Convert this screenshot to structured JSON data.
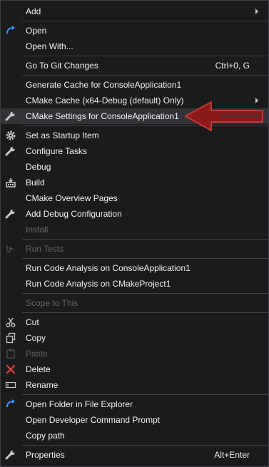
{
  "menu": {
    "items": [
      {
        "label": "Add",
        "shortcut": "",
        "submenu": true,
        "icon": "",
        "disabled": false
      },
      {
        "label": "Open",
        "shortcut": "",
        "submenu": false,
        "icon": "open-arrow-icon",
        "disabled": false
      },
      {
        "label": "Open With...",
        "shortcut": "",
        "submenu": false,
        "icon": "",
        "disabled": false
      },
      {
        "label": "Go To Git Changes",
        "shortcut": "Ctrl+0, G",
        "submenu": false,
        "icon": "",
        "disabled": false
      },
      {
        "label": "Generate Cache for ConsoleApplication1",
        "shortcut": "",
        "submenu": false,
        "icon": "",
        "disabled": false
      },
      {
        "label": "CMake Cache (x64-Debug (default) Only)",
        "shortcut": "",
        "submenu": true,
        "icon": "",
        "disabled": false
      },
      {
        "label": "CMake Settings for ConsoleApplication1",
        "shortcut": "",
        "submenu": false,
        "icon": "wrench-icon",
        "disabled": false,
        "highlighted": true
      },
      {
        "label": "Set as Startup Item",
        "shortcut": "",
        "submenu": false,
        "icon": "gear-icon",
        "disabled": false
      },
      {
        "label": "Configure Tasks",
        "shortcut": "",
        "submenu": false,
        "icon": "wrench-icon",
        "disabled": false
      },
      {
        "label": "Debug",
        "shortcut": "",
        "submenu": false,
        "icon": "",
        "disabled": false
      },
      {
        "label": "Build",
        "shortcut": "",
        "submenu": false,
        "icon": "build-icon",
        "disabled": false
      },
      {
        "label": "CMake Overview Pages",
        "shortcut": "",
        "submenu": false,
        "icon": "",
        "disabled": false
      },
      {
        "label": "Add Debug Configuration",
        "shortcut": "",
        "submenu": false,
        "icon": "wrench-icon",
        "disabled": false
      },
      {
        "label": "Install",
        "shortcut": "",
        "submenu": false,
        "icon": "",
        "disabled": true
      },
      {
        "label": "Run Tests",
        "shortcut": "",
        "submenu": false,
        "icon": "run-tests-icon",
        "disabled": true
      },
      {
        "label": "Run Code Analysis on ConsoleApplication1",
        "shortcut": "",
        "submenu": false,
        "icon": "",
        "disabled": false
      },
      {
        "label": "Run Code Analysis on CMakeProject1",
        "shortcut": "",
        "submenu": false,
        "icon": "",
        "disabled": false
      },
      {
        "label": "Scope to This",
        "shortcut": "",
        "submenu": false,
        "icon": "",
        "disabled": true
      },
      {
        "label": "Cut",
        "shortcut": "",
        "submenu": false,
        "icon": "scissors-icon",
        "disabled": false
      },
      {
        "label": "Copy",
        "shortcut": "",
        "submenu": false,
        "icon": "copy-icon",
        "disabled": false
      },
      {
        "label": "Paste",
        "shortcut": "",
        "submenu": false,
        "icon": "paste-icon",
        "disabled": true
      },
      {
        "label": "Delete",
        "shortcut": "",
        "submenu": false,
        "icon": "delete-x-icon",
        "disabled": false
      },
      {
        "label": "Rename",
        "shortcut": "",
        "submenu": false,
        "icon": "rename-icon",
        "disabled": false
      },
      {
        "label": "Open Folder in File Explorer",
        "shortcut": "",
        "submenu": false,
        "icon": "open-arrow-icon",
        "disabled": false
      },
      {
        "label": "Open Developer Command Prompt",
        "shortcut": "",
        "submenu": false,
        "icon": "",
        "disabled": false
      },
      {
        "label": "Copy path",
        "shortcut": "",
        "submenu": false,
        "icon": "",
        "disabled": false
      },
      {
        "label": "Properties",
        "shortcut": "Alt+Enter",
        "submenu": false,
        "icon": "wrench-icon",
        "disabled": false
      }
    ]
  },
  "colors": {
    "menu_bg": "#1b1b1c",
    "highlight_bg": "#333337",
    "text": "#f1f1f1",
    "disabled_text": "#656565",
    "separator": "#3f3f46",
    "callout_arrow": "#8b1a1a",
    "open_icon": "#3794ff",
    "delete_icon": "#e0443a"
  }
}
